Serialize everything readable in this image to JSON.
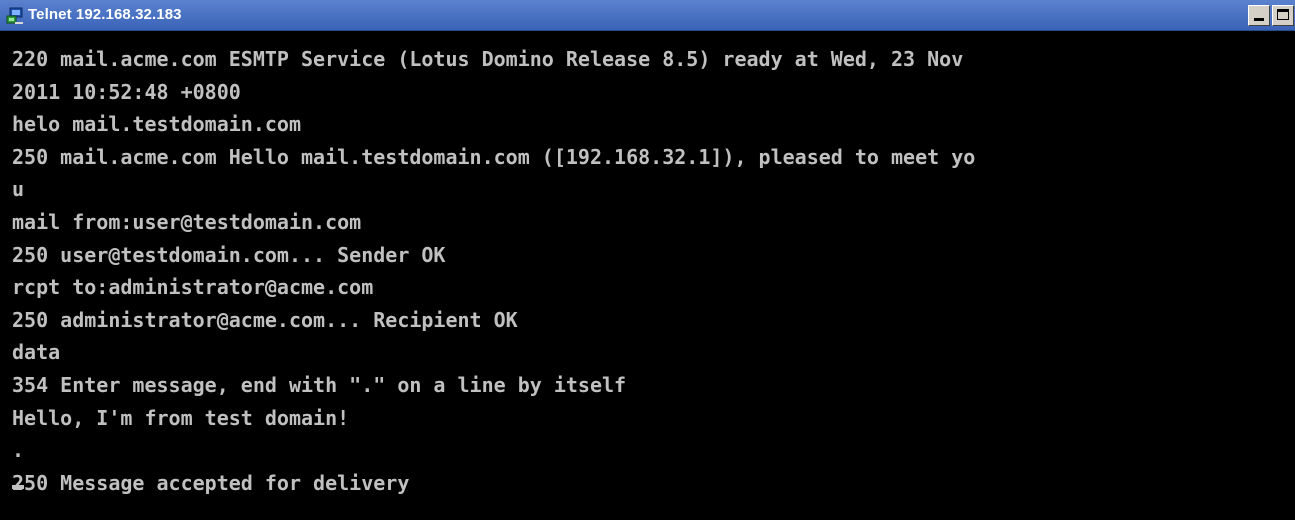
{
  "window": {
    "title": "Telnet 192.168.32.183",
    "icon": "telnet-app-icon",
    "controls": [
      "minimize",
      "maximize"
    ],
    "colors": {
      "titlebar": "#3a64b8",
      "console_background": "#000000",
      "console_text": "#c0c0c0"
    }
  },
  "console": {
    "lines": [
      "220 mail.acme.com ESMTP Service (Lotus Domino Release 8.5) ready at Wed, 23 Nov",
      "2011 10:52:48 +0800",
      "helo mail.testdomain.com",
      "250 mail.acme.com Hello mail.testdomain.com ([192.168.32.1]), pleased to meet yo",
      "u",
      "mail from:user@testdomain.com",
      "250 user@testdomain.com... Sender OK",
      "rcpt to:administrator@acme.com",
      "250 administrator@acme.com... Recipient OK",
      "data",
      "354 Enter message, end with \".\" on a line by itself",
      "Hello, I'm from test domain!",
      ".",
      "250 Message accepted for delivery"
    ]
  }
}
